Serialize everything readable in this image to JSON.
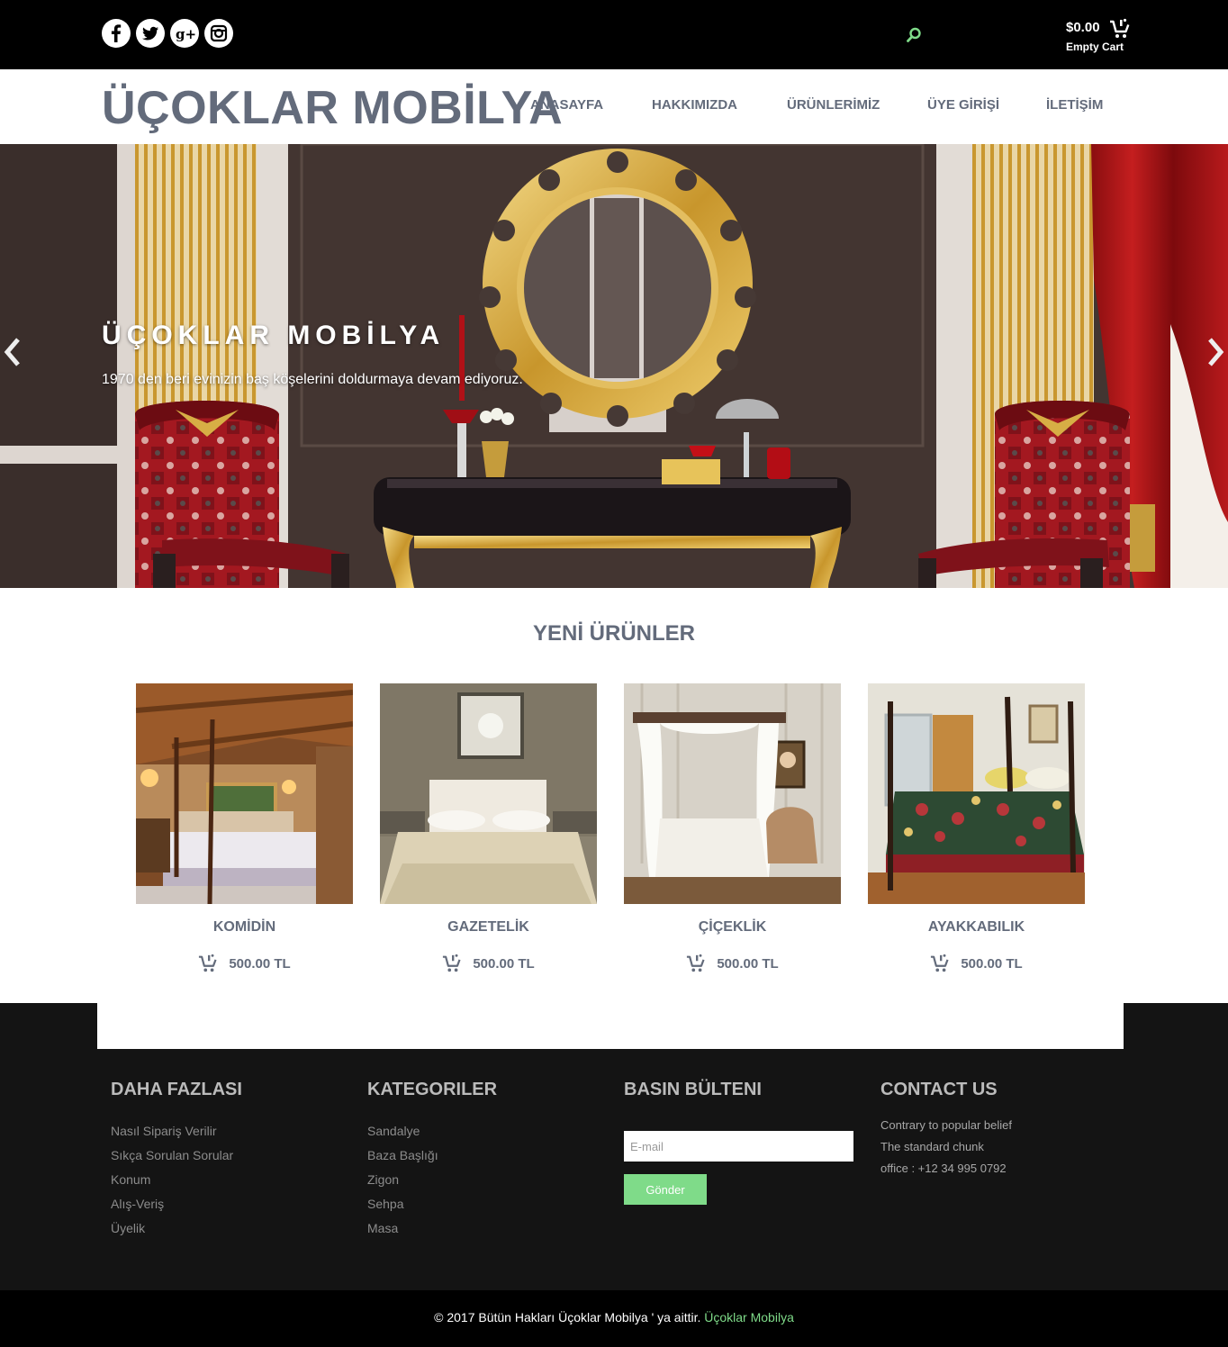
{
  "topbar": {
    "social": [
      {
        "icon": "facebook-icon",
        "glyph": "f"
      },
      {
        "icon": "twitter-icon",
        "glyph": "t"
      },
      {
        "icon": "google-plus-icon",
        "glyph": "g+"
      },
      {
        "icon": "instagram-icon",
        "glyph": "ig"
      }
    ],
    "search_icon": "search-icon",
    "cart": {
      "amount": "$0.00",
      "status": "Empty Cart",
      "icon": "cart-icon"
    }
  },
  "header": {
    "logo": "ÜÇOKLAR MOBİLYA",
    "nav": [
      "ANASAYFA",
      "HAKKIMIZDA",
      "ÜRÜNLERİMİZ",
      "ÜYE GİRİŞİ",
      "İLETİŞİM"
    ]
  },
  "hero": {
    "title": "ÜÇOKLAR MOBİLYA",
    "subtitle": "1970 den beri evinizin baş köşelerini doldurmaya devam ediyoruz."
  },
  "products": {
    "title": "YENİ ÜRÜNLER",
    "items": [
      {
        "name": "KOMİDİN",
        "price": "500.00 TL"
      },
      {
        "name": "GAZETELİK",
        "price": "500.00 TL"
      },
      {
        "name": "ÇİÇEKLİK",
        "price": "500.00 TL"
      },
      {
        "name": "AYAKKABILIK",
        "price": "500.00 TL"
      }
    ]
  },
  "footer": {
    "more": {
      "title": "DAHA FAZLASI",
      "links": [
        "Nasıl Sipariş Verilir",
        "Sıkça Sorulan Sorular",
        "Konum",
        "Alış-Veriş",
        "Üyelik"
      ]
    },
    "categories": {
      "title": "KATEGORILER",
      "links": [
        "Sandalye",
        "Baza Başlığı",
        "Zigon",
        "Sehpa",
        "Masa"
      ]
    },
    "newsletter": {
      "title": "BASIN BÜLTENI",
      "placeholder": "E-mail",
      "button": "Gönder"
    },
    "contact": {
      "title": "CONTACT US",
      "lines": [
        "Contrary to popular belief",
        "The standard chunk",
        "office : +12 34 995 0792"
      ]
    }
  },
  "copyright": {
    "text": "© 2017 Bütün Hakları Üçoklar Mobilya ' ya aittir.",
    "link": "Üçoklar Mobilya"
  },
  "colors": {
    "accent": "#7fdb89",
    "heading": "#636b7b",
    "topbar": "#000000",
    "footer": "#141414"
  }
}
